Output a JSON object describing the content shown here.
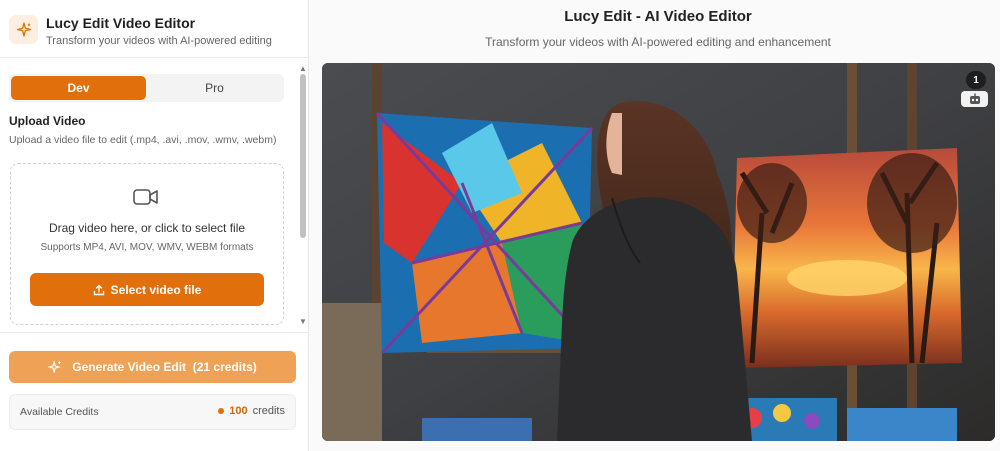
{
  "app": {
    "title": "Lucy Edit Video Editor",
    "subtitle": "Transform your videos with AI-powered editing",
    "logo_icon": "sparkles-icon"
  },
  "tabs": [
    {
      "label": "Dev",
      "active": true
    },
    {
      "label": "Pro",
      "active": false
    }
  ],
  "upload": {
    "title": "Upload Video",
    "description": "Upload a video file to edit (.mp4, .avi, .mov, .wmv, .webm)",
    "drop_icon": "video-camera-icon",
    "drop_title": "Drag video here, or click to select file",
    "drop_formats": "Supports MP4, AVI, MOV, WMV, WEBM formats",
    "select_button": "Select video file",
    "select_icon": "upload-icon"
  },
  "generate": {
    "label": "Generate Video Edit  (21 credits)",
    "icon": "sparkles-icon"
  },
  "credits": {
    "label": "Available Credits",
    "value": "100",
    "unit": "credits"
  },
  "main": {
    "title": "Lucy Edit - AI Video Editor",
    "subtitle": "Transform your videos with AI-powered editing and enhancement",
    "badge_count": "1",
    "badge_icon": "robot-icon"
  },
  "colors": {
    "accent": "#e06f0c",
    "accent_light": "#efa156"
  }
}
